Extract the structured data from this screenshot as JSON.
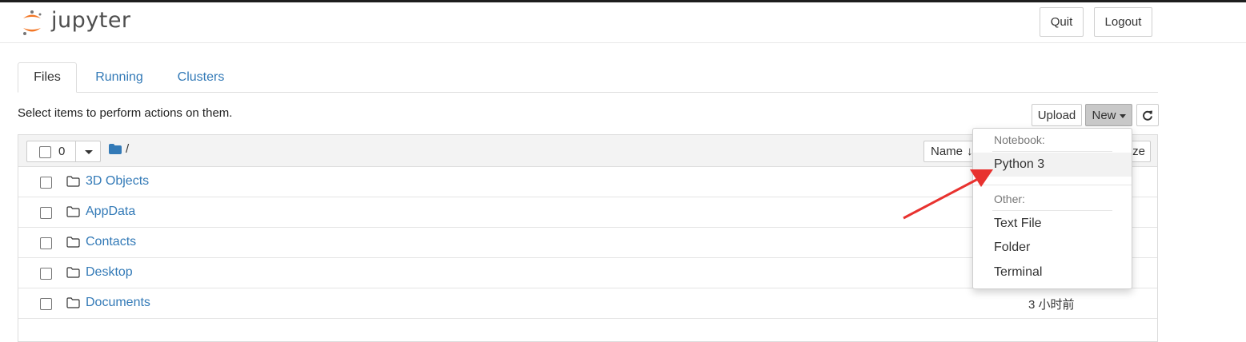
{
  "header": {
    "logo_text": "jupyter",
    "quit_label": "Quit",
    "logout_label": "Logout"
  },
  "tabs": [
    {
      "label": "Files",
      "active": true
    },
    {
      "label": "Running",
      "active": false
    },
    {
      "label": "Clusters",
      "active": false
    }
  ],
  "toolbar": {
    "hint": "Select items to perform actions on them.",
    "upload_label": "Upload",
    "new_label": "New",
    "refresh_icon": "refresh-icon"
  },
  "list_header": {
    "selected_count": "0",
    "root_path": "/",
    "name_sort_label": "Name",
    "size_label": "ze"
  },
  "files": [
    {
      "name": "3D Objects",
      "modified": ""
    },
    {
      "name": "AppData",
      "modified": ""
    },
    {
      "name": "Contacts",
      "modified": ""
    },
    {
      "name": "Desktop",
      "modified": ""
    },
    {
      "name": "Documents",
      "modified": "3 小时前"
    }
  ],
  "new_menu": {
    "notebook_header": "Notebook:",
    "python3": "Python 3",
    "other_header": "Other:",
    "text_file": "Text File",
    "folder": "Folder",
    "terminal": "Terminal"
  },
  "colors": {
    "link": "#337ab7",
    "logo_orange": "#f37726",
    "annotation_arrow": "#e8322f"
  }
}
